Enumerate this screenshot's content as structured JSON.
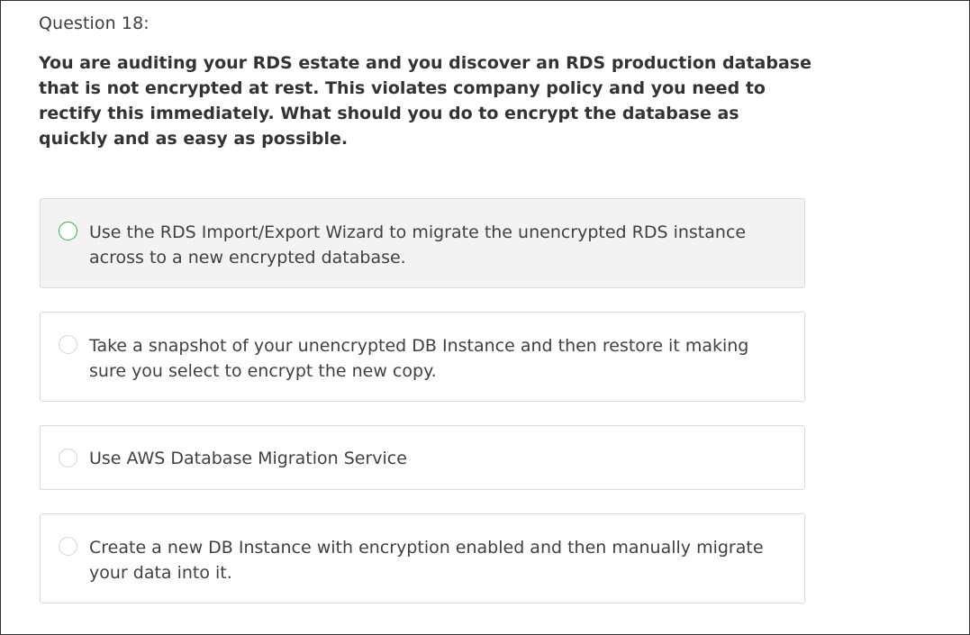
{
  "question": {
    "number_label": "Question 18:",
    "text": "You are auditing your RDS estate and you discover an RDS production database that is not encrypted at rest. This violates company policy and you need to rectify this immediately. What should you do to encrypt the database as quickly and as easy as possible."
  },
  "options": [
    {
      "label": "Use the RDS Import/Export Wizard to migrate the unencrypted RDS instance across to a new encrypted database.",
      "hovered": true,
      "selected": false
    },
    {
      "label": "Take a snapshot of your unencrypted DB Instance and then restore it making sure you select to encrypt the new copy.",
      "hovered": false,
      "selected": false
    },
    {
      "label": "Use AWS Database Migration Service",
      "hovered": false,
      "selected": false
    },
    {
      "label": "Create a new DB Instance with encryption enabled and then manually migrate your data into it.",
      "hovered": false,
      "selected": false
    }
  ],
  "colors": {
    "hover_background": "#f3f3f3",
    "hover_radio_border": "#2db24a",
    "option_border": "#dcdcdc",
    "frame_border": "#333333"
  }
}
